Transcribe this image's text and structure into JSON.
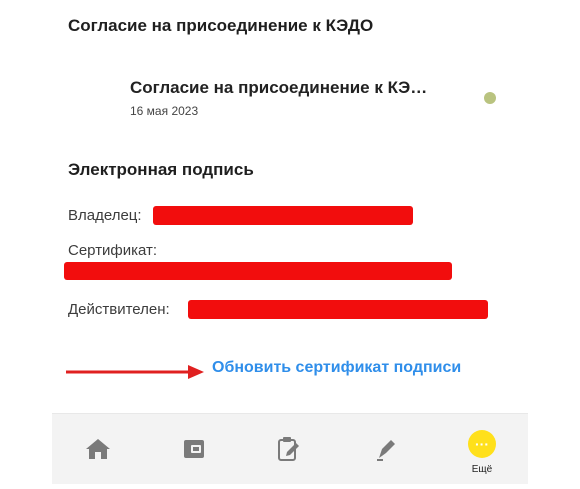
{
  "header": {
    "title": "Согласие на присоединение к КЭДО"
  },
  "document": {
    "title": "Согласие на присоединение к КЭ…",
    "date": "16 мая 2023",
    "status_color": "#b9c37f"
  },
  "signature": {
    "section_title": "Электронная подпись",
    "owner_label": "Владелец:",
    "certificate_label": "Сертификат:",
    "valid_label": "Действителен:",
    "redaction_color": "#f20d0d"
  },
  "update_link": {
    "label": "Обновить сертификат подписи",
    "color": "#2f8eea"
  },
  "tabbar": {
    "items": [
      {
        "icon": "home-icon"
      },
      {
        "icon": "wallet-icon"
      },
      {
        "icon": "clipboard-edit-icon"
      },
      {
        "icon": "sign-pen-icon"
      },
      {
        "icon": "more-icon",
        "label": "Ещё"
      }
    ],
    "more_glyph": "···"
  }
}
